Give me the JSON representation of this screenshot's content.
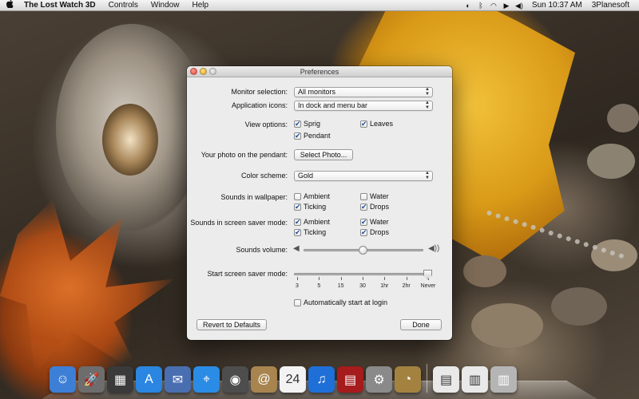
{
  "menubar": {
    "apple_icon": "apple-icon",
    "app_name": "The Lost Watch 3D",
    "menus": [
      "Controls",
      "Window",
      "Help"
    ],
    "status_icons": [
      "bluetooth-icon",
      "wifi-icon",
      "play-icon",
      "volume-icon"
    ],
    "clock": "Sun 10:37 AM",
    "user": "3Planesoft"
  },
  "window": {
    "title": "Preferences",
    "monitor_selection": {
      "label": "Monitor selection:",
      "value": "All monitors"
    },
    "application_icons": {
      "label": "Application icons:",
      "value": "In dock and menu bar"
    },
    "view_options": {
      "label": "View options:",
      "items": [
        {
          "label": "Sprig",
          "checked": true
        },
        {
          "label": "Leaves",
          "checked": true
        },
        {
          "label": "Pendant",
          "checked": true
        }
      ]
    },
    "photo": {
      "label": "Your photo on the pendant:",
      "button": "Select Photo..."
    },
    "color_scheme": {
      "label": "Color scheme:",
      "value": "Gold"
    },
    "sounds_wallpaper": {
      "label": "Sounds in wallpaper:",
      "items": [
        {
          "label": "Ambient",
          "checked": false
        },
        {
          "label": "Water",
          "checked": false
        },
        {
          "label": "Ticking",
          "checked": true
        },
        {
          "label": "Drops",
          "checked": true
        }
      ]
    },
    "sounds_screensaver": {
      "label": "Sounds in screen saver mode:",
      "items": [
        {
          "label": "Ambient",
          "checked": true
        },
        {
          "label": "Water",
          "checked": true
        },
        {
          "label": "Ticking",
          "checked": true
        },
        {
          "label": "Drops",
          "checked": true
        }
      ]
    },
    "sounds_volume": {
      "label": "Sounds volume:",
      "level": 0.5
    },
    "screensaver_start": {
      "label": "Start screen saver mode:",
      "ticks": [
        "3",
        "5",
        "15",
        "30",
        "1hr",
        "2hr",
        "Never"
      ],
      "selected": "Never"
    },
    "auto_start": {
      "label": "Automatically start at login",
      "checked": false
    },
    "revert_button": "Revert to Defaults",
    "done_button": "Done"
  },
  "dock": {
    "items": [
      {
        "name": "finder-icon",
        "color": "#3d7fd6",
        "glyph": "☺"
      },
      {
        "name": "launchpad-icon",
        "color": "#6d6d6d",
        "glyph": "🚀"
      },
      {
        "name": "dashboard-icon",
        "color": "#3a3a3a",
        "glyph": "▦"
      },
      {
        "name": "app-store-icon",
        "color": "#2a86e0",
        "glyph": "A"
      },
      {
        "name": "mail-stamp-icon",
        "color": "#4a6fb0",
        "glyph": "✉"
      },
      {
        "name": "safari-icon",
        "color": "#2b8ce6",
        "glyph": "⌖"
      },
      {
        "name": "facetime-icon",
        "color": "#4d4d4d",
        "glyph": "◉"
      },
      {
        "name": "contacts-icon",
        "color": "#a8844f",
        "glyph": "@"
      },
      {
        "name": "calendar-icon",
        "color": "#f3f3f3",
        "glyph": "24"
      },
      {
        "name": "itunes-icon",
        "color": "#1f6fd8",
        "glyph": "♫"
      },
      {
        "name": "photo-booth-icon",
        "color": "#a61c1c",
        "glyph": "▤"
      },
      {
        "name": "system-preferences-icon",
        "color": "#8a8a8a",
        "glyph": "⚙"
      },
      {
        "name": "lost-watch-icon",
        "color": "#a38240",
        "glyph": "◔"
      },
      {
        "name": "document-icon",
        "color": "#e9e9e9",
        "glyph": "▤"
      },
      {
        "name": "document-icon",
        "color": "#e9e9e9",
        "glyph": "▥"
      },
      {
        "name": "trash-icon",
        "color": "#b5b5b5",
        "glyph": "▥"
      }
    ]
  }
}
